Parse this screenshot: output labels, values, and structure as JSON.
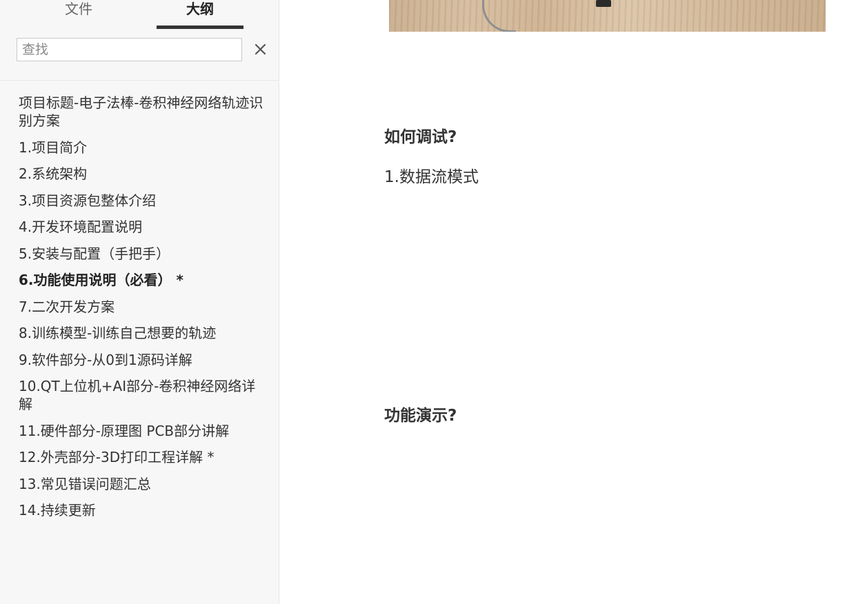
{
  "sidebar": {
    "tabs": {
      "files": "文件",
      "outline": "大纲"
    },
    "search": {
      "placeholder": "查找",
      "value": ""
    },
    "clear_icon": "close-icon",
    "outline_items": [
      "项目标题-电子法棒-卷积神经网络轨迹识别方案",
      "1.项目简介",
      "2.系统架构",
      "3.项目资源包整体介绍",
      "4.开发环境配置说明",
      "5.安装与配置（手把手）",
      "6.功能使用说明（必看） *",
      "7.二次开发方案",
      "8.训练模型-训练自己想要的轨迹",
      "9.软件部分-从0到1源码详解",
      "10.QT上位机+AI部分-卷积神经网络详解",
      "11.硬件部分-原理图 PCB部分讲解",
      "12.外壳部分-3D打印工程详解 *",
      "13.常见错误问题汇总",
      "14.持续更新"
    ],
    "active_index": 6
  },
  "main": {
    "heading_debug": "如何调试?",
    "paragraph_mode": "1.数据流模式",
    "heading_demo": "功能演示?"
  },
  "colors": {
    "sidebar_bg": "#f7f7f7",
    "text": "#333333",
    "active_tab_underline": "#333333"
  }
}
